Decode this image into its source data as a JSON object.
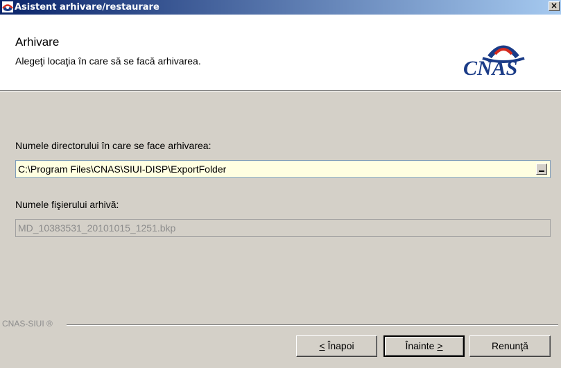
{
  "window": {
    "title": "Asistent arhivare/restaurare",
    "close_label": "×"
  },
  "header": {
    "title": "Arhivare",
    "subtitle": "Alegeţi locaţia în care să se facă arhivarea.",
    "logo_text": "CNAS"
  },
  "form": {
    "directory_label": "Numele directorului în care se face arhivarea:",
    "directory_value": "C:\\Program Files\\CNAS\\SIUI-DISP\\ExportFolder",
    "file_label": "Numele fişierului arhivă:",
    "file_value": "MD_10383531_20101015_1251.bkp"
  },
  "footer": {
    "brand": "CNAS-SIUI ®",
    "back_label": "Înapoi",
    "back_accel": "<",
    "next_label": "Înainte",
    "next_accel": ">",
    "cancel_label": "Renunţă"
  },
  "colors": {
    "title_start": "#0a246a",
    "title_end": "#a6caf0",
    "input_bg": "#ffffe1",
    "logo": "#1a3b87",
    "logo_accent": "#d52b1e"
  }
}
